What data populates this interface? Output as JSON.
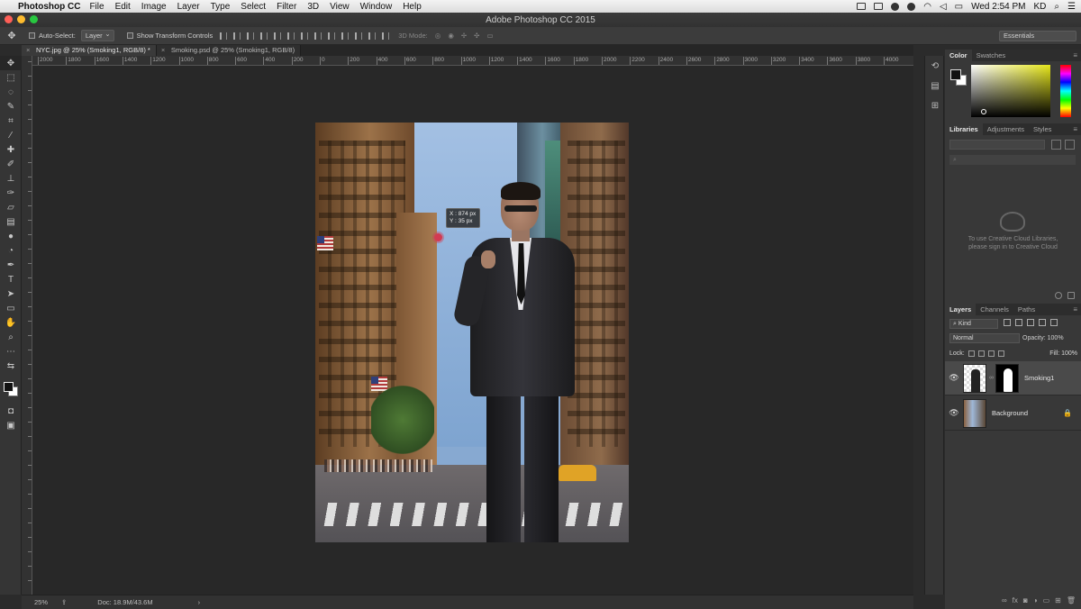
{
  "menubar": {
    "app_name": "Photoshop CC",
    "items": [
      "File",
      "Edit",
      "Image",
      "Layer",
      "Type",
      "Select",
      "Filter",
      "3D",
      "View",
      "Window",
      "Help"
    ],
    "clock": "Wed 2:54 PM",
    "user": "KD"
  },
  "window": {
    "title": "Adobe Photoshop CC 2015"
  },
  "options": {
    "auto_select_label": "Auto-Select:",
    "auto_select_value": "Layer",
    "transform_label": "Show Transform Controls",
    "mode_3d_label": "3D Mode:",
    "workspace": "Essentials"
  },
  "tabs": [
    {
      "label": "NYC.jpg @ 25% (Smoking1, RGB/8) *",
      "active": true
    },
    {
      "label": "Smoking.psd @ 25% (Smoking1, RGB/8)",
      "active": false
    }
  ],
  "ruler": {
    "top_labels": [
      "2000",
      "1800",
      "1600",
      "1400",
      "1200",
      "1000",
      "800",
      "600",
      "400",
      "200",
      "0",
      "200",
      "400",
      "600",
      "800",
      "1000",
      "1200",
      "1400",
      "1600",
      "1800",
      "2000",
      "2200",
      "2400",
      "2600",
      "2800",
      "3000",
      "3200",
      "3400",
      "3600",
      "3800",
      "4000"
    ]
  },
  "canvas": {
    "tooltip_x": "X : 874 px",
    "tooltip_y": "Y : 35 px"
  },
  "statusbar": {
    "zoom": "25%",
    "doc": "Doc: 18.9M/43.6M",
    "arrow": "›"
  },
  "panels": {
    "color_tabs": [
      "Color",
      "Swatches"
    ],
    "library_tabs": [
      "Libraries",
      "Adjustments",
      "Styles"
    ],
    "library_message_1": "To use Creative Cloud Libraries,",
    "library_message_2": "please sign in to Creative Cloud",
    "layers_tabs": [
      "Layers",
      "Channels",
      "Paths"
    ],
    "filter_kind": "Kind",
    "blend_mode": "Normal",
    "opacity_label": "Opacity:",
    "opacity_value": "100%",
    "lock_label": "Lock:",
    "fill_label": "Fill:",
    "fill_value": "100%",
    "layers": [
      {
        "name": "Smoking1",
        "selected": true
      },
      {
        "name": "Background",
        "selected": false
      }
    ]
  },
  "colors": {
    "accent_selected_layer": "#4a4a4a",
    "cursor": "#d23b52"
  }
}
